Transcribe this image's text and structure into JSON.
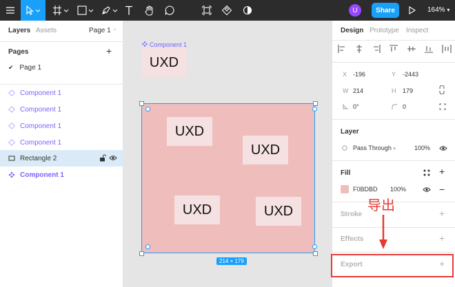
{
  "toolbar": {
    "avatar_letter": "U",
    "share_label": "Share",
    "zoom": "164%",
    "tools": [
      "menu-icon",
      "move-tool-icon",
      "frame-tool-icon",
      "rectangle-tool-icon",
      "pen-tool-icon",
      "text-tool-icon",
      "hand-tool-icon",
      "comment-tool-icon",
      "components-icon",
      "component-set-icon",
      "contrast-icon",
      "play-icon"
    ]
  },
  "left_panel": {
    "tabs": {
      "layers": "Layers",
      "assets": "Assets",
      "page": "Page 1"
    },
    "pages_header": "Pages",
    "pages": [
      {
        "label": "Page 1",
        "checked": "✔"
      }
    ],
    "layers": [
      {
        "label": "Component 1",
        "type": "component-instance"
      },
      {
        "label": "Component 1",
        "type": "component-instance"
      },
      {
        "label": "Component 1",
        "type": "component-instance"
      },
      {
        "label": "Component 1",
        "type": "component-instance"
      },
      {
        "label": "Rectangle 2",
        "type": "rectangle",
        "selected": true
      },
      {
        "label": "Component 1",
        "type": "component-main"
      }
    ]
  },
  "canvas": {
    "component_label": "Component 1",
    "main_uxd": "UXD",
    "frame_uxd": [
      "UXD",
      "UXD",
      "UXD",
      "UXD"
    ],
    "size_badge": "214 × 179"
  },
  "right_panel": {
    "tabs": {
      "design": "Design",
      "prototype": "Prototype",
      "inspect": "Inspect"
    },
    "props": {
      "x_label": "X",
      "x": "-196",
      "y_label": "Y",
      "y": "-2443",
      "w_label": "W",
      "w": "214",
      "h_label": "H",
      "h": "179",
      "rotation": "0°",
      "radius": "0"
    },
    "layer": {
      "header": "Layer",
      "blend": "Pass Through",
      "opacity": "100%"
    },
    "fill": {
      "header": "Fill",
      "hex": "F0BDBD",
      "opacity": "100%",
      "color": "#F0BDBD"
    },
    "stroke_header": "Stroke",
    "effects_header": "Effects",
    "export_header": "Export"
  },
  "annotation": {
    "text": "导出",
    "color": "#E53935"
  }
}
